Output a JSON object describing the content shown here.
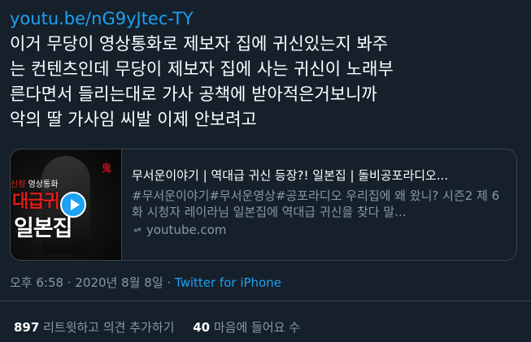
{
  "tweet": {
    "link": "youtu.be/nG9yJtec-TY",
    "lines": [
      "이거 무당이 영상통화로 제보자 집에 귀신있는지 봐주",
      "는 컨텐츠인데 무당이 제보자 집에 사는 귀신이 노래부",
      "른다면서 들리는대로 가사 공책에 받아적은거보니까",
      "악의 딸 가사임 씨발 이제 안보려고"
    ]
  },
  "card": {
    "thumb_top_red": "신청",
    "thumb_top_white": "영상통화",
    "thumb_mid": "대급귀",
    "thumb_bottom": "일본집",
    "thumb_mark": "鬼",
    "title": "무서운이야기 | 역대급 귀신 등장?! 일본집 | 돌비공포라디오...",
    "description": "#무서운이야기#무서운영상#공포라디오 우리집에 왜 왔니? 시즌2 제 6화 시청자 레이라님 일본집에 역대급 귀신을 찾다 말...",
    "domain": "youtube.com"
  },
  "meta": {
    "time": "오후 6:58",
    "sep1": " · ",
    "date": "2020년 8월 8일",
    "sep2": " · ",
    "source": "Twitter for iPhone"
  },
  "stats": {
    "retweets_count": "897",
    "retweets_label": "리트윗하고 의견 추가하기",
    "likes_count": "40",
    "likes_label": "마음에 들어요 수"
  },
  "colors": {
    "background": "#15202b",
    "accent": "#1da1f2",
    "muted": "#8899a6",
    "border": "#38444d"
  }
}
